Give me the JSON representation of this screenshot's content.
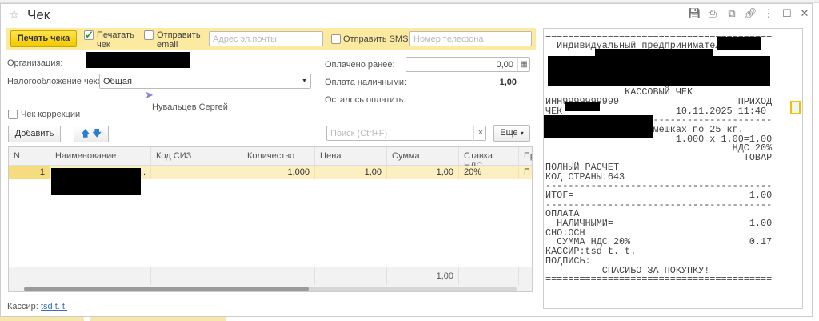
{
  "window": {
    "title": "Чек",
    "icons": [
      "star-icon",
      "save-icon",
      "print-icon",
      "preview-icon",
      "link-icon",
      "more-icon",
      "maximize-icon",
      "close-icon"
    ]
  },
  "toolbar": {
    "print_button": "Печать чека",
    "print_check_label": "Печатать чек",
    "print_check_checked": true,
    "send_email_label": "Отправить email",
    "email_placeholder": "Адрес эл.почты",
    "send_sms_label": "Отправить SMS",
    "phone_placeholder": "Номер телефона"
  },
  "form": {
    "organization_label": "Организация:",
    "taxation_label": "Налогообложение чека:",
    "taxation_value": "Общая",
    "cursor_tooltip": "Нувальцев Сергей",
    "correction_label": "Чек коррекции",
    "paid_before_label": "Оплачено ранее:",
    "paid_before_value": "0,00",
    "cash_label": "Оплата наличными:",
    "cash_value": "1,00",
    "remaining_label": "Осталось оплатить:"
  },
  "table_toolbar": {
    "add_button": "Добавить",
    "search_placeholder": "Поиск (Ctrl+F)",
    "clear": "×",
    "more_button": "Еще"
  },
  "table": {
    "columns": [
      "N",
      "Наименование",
      "Код СИЗ",
      "Количество",
      "Цена",
      "Сумма",
      "Ставка НДС",
      "Пр"
    ],
    "rows": [
      {
        "n": "1",
        "name": "...",
        "siz": "",
        "qty": "1,000",
        "price": "1,00",
        "sum": "1,00",
        "vat": "20%",
        "pr": "П"
      }
    ],
    "footer_sum": "1,00"
  },
  "cashier": {
    "label": "Кассир:",
    "value": "tsd t. t."
  },
  "receipt": {
    "lines": [
      "========================================",
      "  Индивидуальный предприниматель",
      "",
      "",
      "",
      "",
      "              КАССОВЫЙ ЧЕК",
      "ИНН9999999999                     ПРИХОД",
      "ЧЕК                    10.11.2025 11:40",
      "                  ----------------------",
      "                   мешках по 25 кг.",
      "                       1.000 x 1.00=1.00",
      "                                 НДС 20%",
      "                                   ТОВАР",
      "ПОЛНЫЙ РАСЧЕТ",
      "КОД СТРАНЫ:643",
      "----------------------------------------",
      "ИТОГ=                               1.00",
      "----------------------------------------",
      "ОПЛАТА",
      "  НАЛИЧНЫМИ=                        1.00",
      "СНО:ОСН",
      "  СУММА НДС 20%                     0.17",
      "КАССИР:tsd t. t.",
      "ПОДПИСЬ:",
      "          СПАСИБО ЗА ПОКУПКУ!",
      "========================================"
    ]
  }
}
